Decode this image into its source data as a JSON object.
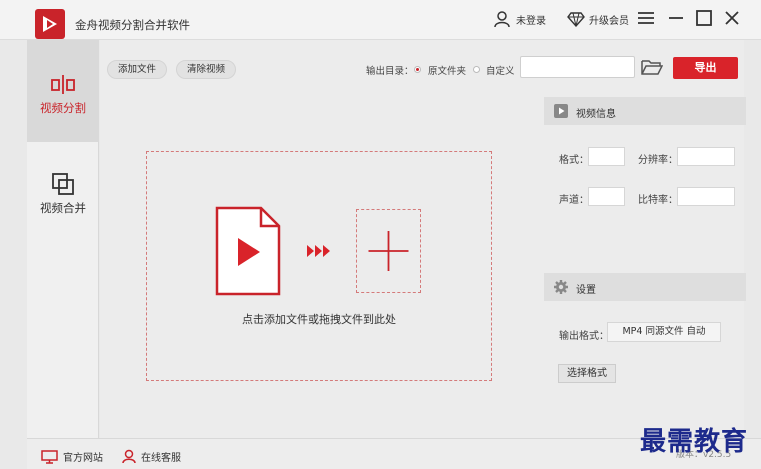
{
  "app": {
    "title": "金舟视频分割合并软件"
  },
  "header": {
    "login_label": "未登录",
    "upgrade_label": "升级会员"
  },
  "sidebar": {
    "items": [
      {
        "label": "视频分割",
        "icon": "split-icon",
        "active": true
      },
      {
        "label": "视频合并",
        "icon": "merge-icon",
        "active": false
      }
    ]
  },
  "toolbar": {
    "add_file_label": "添加文件",
    "clear_label": "清除视频",
    "output_dir_label": "输出目录：",
    "output_options": [
      {
        "label": "原文件夹",
        "selected": true
      },
      {
        "label": "自定义",
        "selected": false
      }
    ],
    "path_value": "",
    "export_label": "导出"
  },
  "dropzone": {
    "hint": "点击添加文件或拖拽文件到此处"
  },
  "video_info": {
    "title": "视频信息",
    "fields": {
      "format": "格式：",
      "resolution": "分辨率：",
      "channel": "声道：",
      "bitrate": "比特率："
    }
  },
  "settings": {
    "title": "设置",
    "output_format_label": "输出格式：",
    "output_format_value": "MP4 同源文件 自动",
    "choose_format_label": "选择格式"
  },
  "footer": {
    "website_label": "官方网站",
    "support_label": "在线客服",
    "version": "版本：v2.5.5"
  },
  "watermark": "最需教育",
  "colors": {
    "accent": "#c9232a",
    "export": "#d9232a"
  }
}
